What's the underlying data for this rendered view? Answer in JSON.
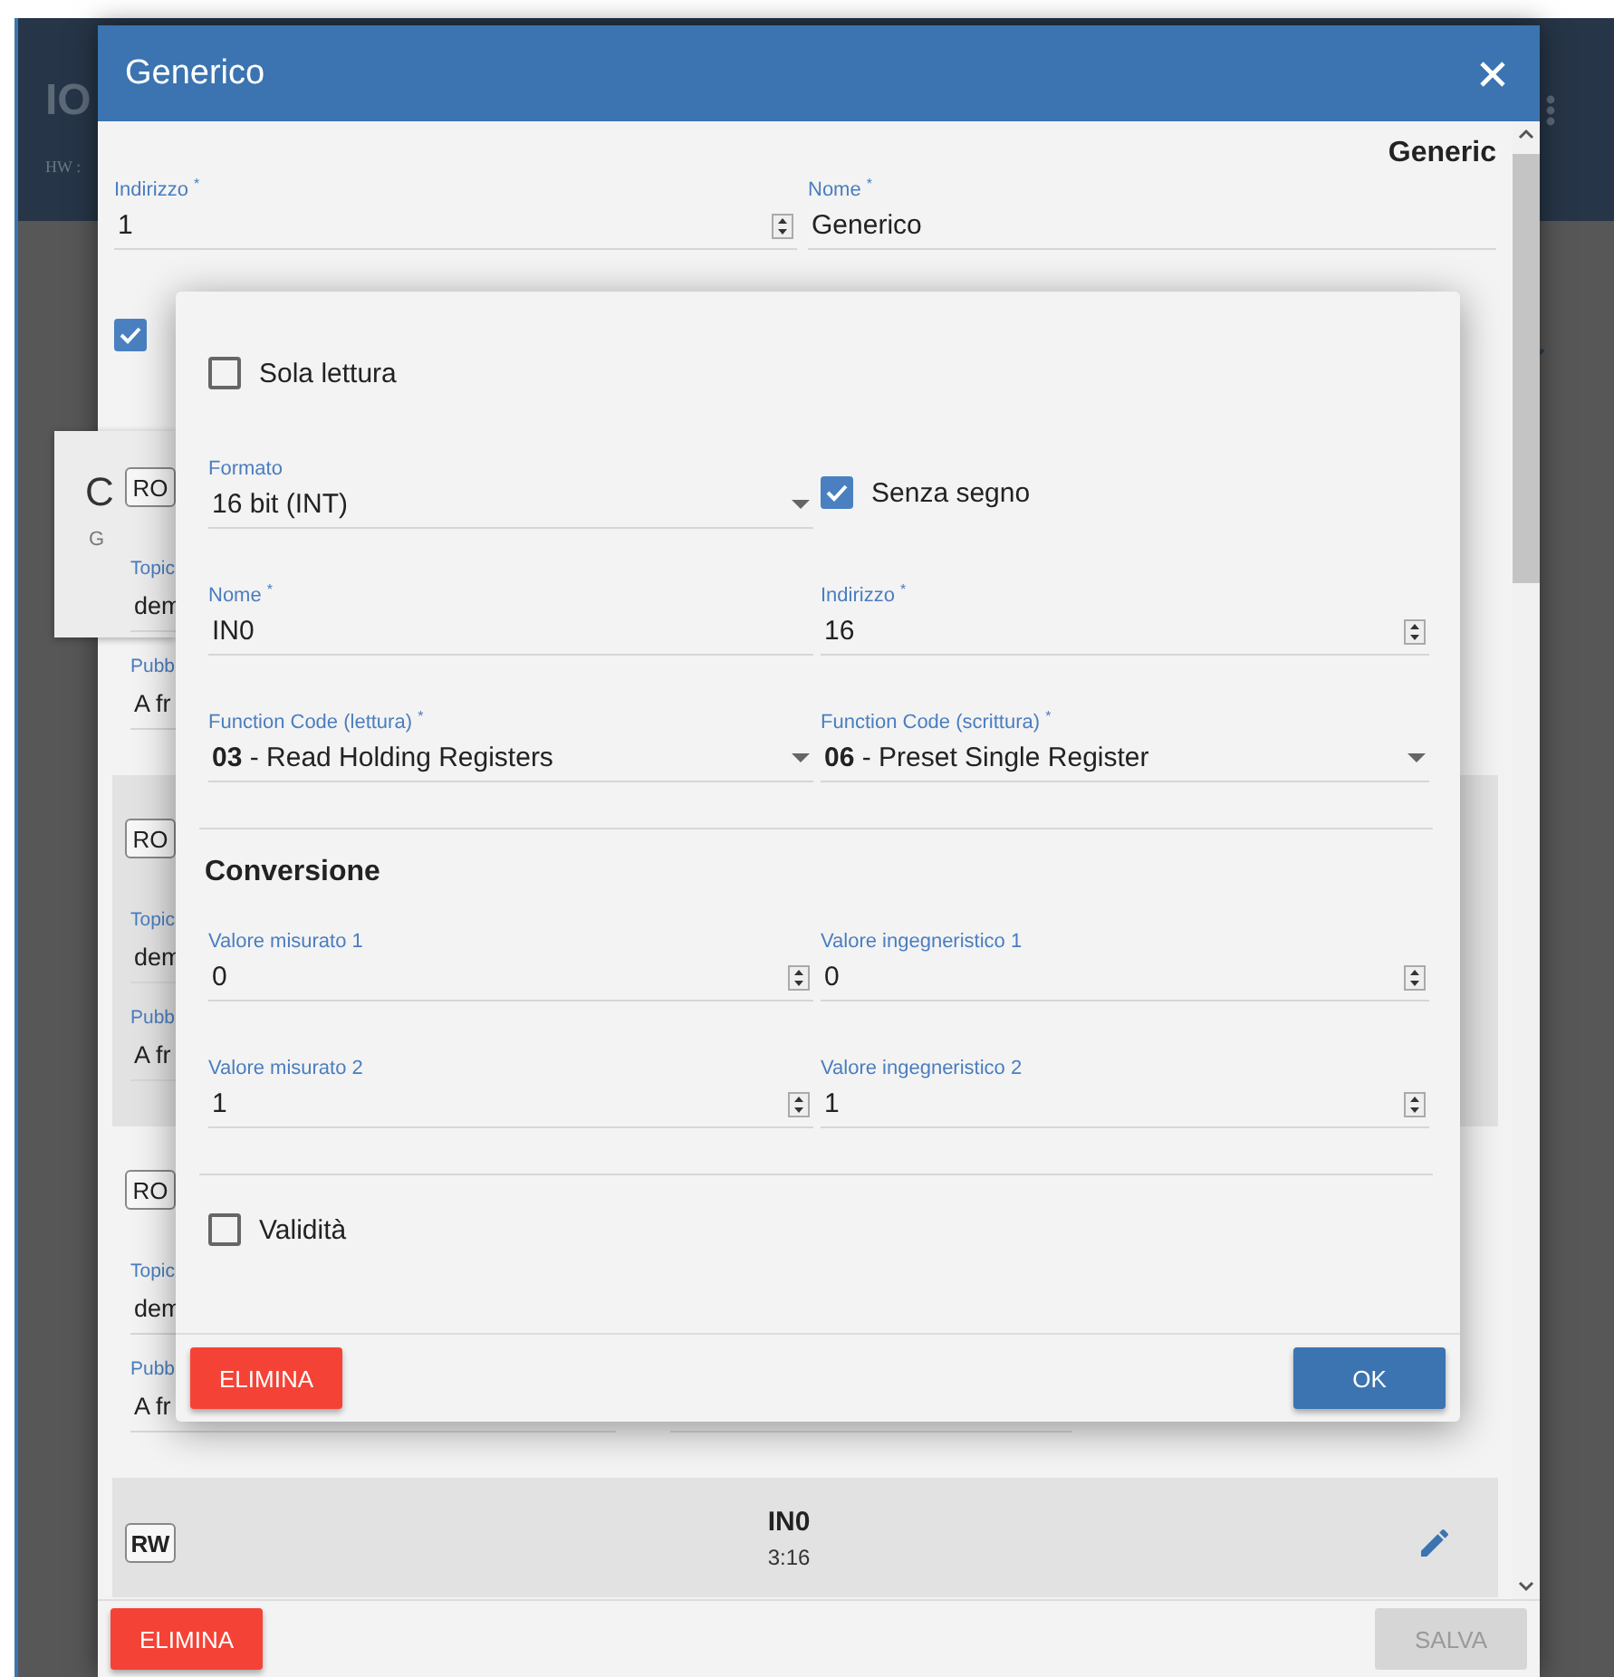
{
  "background": {
    "title": "IO",
    "hw_label": "HW :"
  },
  "card": {
    "title": "C",
    "subtitle": "G"
  },
  "dialog": {
    "title": "Generico",
    "type_label": "Generic",
    "fields": [
      {
        "kind": "number",
        "label": "Indirizzo $^{*}$",
        "value": "1"
      },
      {
        "kind": "text",
        "label": "Nome $^{*}$",
        "value": "Generico"
      }
    ],
    "enabled": {
      "checked": true
    },
    "items": [
      {
        "kind": "mqtt",
        "access": "RO",
        "highlighted": false,
        "fields": [
          {
            "label": "Topic",
            "value": "dem"
          },
          {
            "label": "Pubb",
            "value": "A fr"
          }
        ]
      },
      {
        "kind": "mqtt",
        "access": "RO",
        "highlighted": true,
        "fields": [
          {
            "label": "Topic",
            "value": "dem"
          },
          {
            "label": "Pubb",
            "value": "A fr"
          }
        ]
      },
      {
        "kind": "mqtt",
        "access": "RO",
        "highlighted": false,
        "fields": [
          {
            "label": "Topic",
            "value": "dem"
          },
          {
            "label": "Pubb",
            "value": "A fr"
          }
        ]
      },
      {
        "kind": "register",
        "access": "RW",
        "highlighted": true,
        "name": "IN0",
        "address": "3:16"
      }
    ],
    "buttons": [
      {
        "kind": "danger",
        "label": "ELIMINA",
        "disabled": false
      },
      {
        "kind": "save",
        "label": "SALVA",
        "disabled": true
      }
    ]
  },
  "register_dialog": {
    "read_only": {
      "label": "Sola lettura",
      "checked": false
    },
    "format": {
      "kind": "select",
      "label": "Formato",
      "value": "16 bit (INT)"
    },
    "unsigned": {
      "label": "Senza segno",
      "checked": true
    },
    "fields": [
      {
        "kind": "text",
        "label": "Nome $^{*}$",
        "value": "IN0"
      },
      {
        "kind": "number",
        "label": "Indirizzo $^{*}$",
        "value": "16"
      },
      {
        "kind": "select",
        "label": "Function Code (lettura) $^{*}$",
        "value": "**03** - Read Holding Registers"
      },
      {
        "kind": "select",
        "label": "Function Code (scrittura) $^{*}$",
        "value": "**06** - Preset Single Register"
      }
    ],
    "conversion_title": "Conversione",
    "conversion_fields": [
      {
        "kind": "number",
        "label": "Valore misurato 1",
        "value": "0"
      },
      {
        "kind": "number",
        "label": "Valore ingegneristico 1",
        "value": "0"
      },
      {
        "kind": "number",
        "label": "Valore misurato 2",
        "value": "1"
      },
      {
        "kind": "number",
        "label": "Valore ingegneristico 2",
        "value": "1"
      }
    ],
    "validity": {
      "label": "Validità",
      "checked": false
    },
    "buttons": [
      {
        "kind": "danger",
        "label": "ELIMINA",
        "disabled": false
      },
      {
        "kind": "primary",
        "label": "OK",
        "disabled": false
      }
    ]
  }
}
